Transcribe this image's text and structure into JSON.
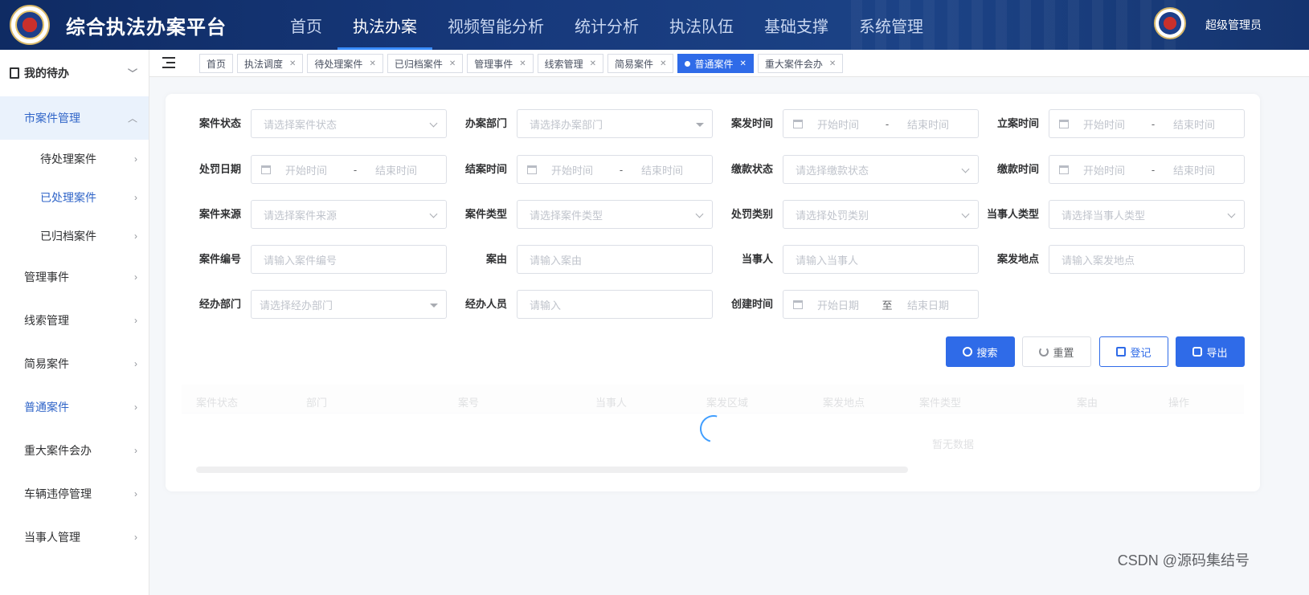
{
  "app": {
    "title": "综合执法办案平台",
    "username": "超级管理员"
  },
  "topnav": [
    {
      "label": "首页"
    },
    {
      "label": "执法办案"
    },
    {
      "label": "视频智能分析"
    },
    {
      "label": "统计分析"
    },
    {
      "label": "执法队伍"
    },
    {
      "label": "基础支撑"
    },
    {
      "label": "系统管理"
    }
  ],
  "topnav_active_index": 1,
  "sidebar": {
    "todo": "我的待办",
    "group": "市案件管理",
    "sub_items": [
      "待处理案件",
      "已处理案件",
      "已归档案件"
    ],
    "items": [
      "管理事件",
      "线索管理",
      "简易案件",
      "普通案件",
      "重大案件会办",
      "车辆违停管理",
      "当事人管理"
    ]
  },
  "tabs": [
    "首页",
    "执法调度",
    "待处理案件",
    "已归档案件",
    "管理事件",
    "线索管理",
    "简易案件",
    "普通案件",
    "重大案件会办"
  ],
  "active_tab_index": 7,
  "form": {
    "case_status": {
      "label": "案件状态",
      "placeholder": "请选择案件状态"
    },
    "dept": {
      "label": "办案部门",
      "placeholder": "请选择办案部门"
    },
    "incident_time": {
      "label": "案发时间",
      "start": "开始时间",
      "sep": "-",
      "end": "结束时间"
    },
    "filing_time": {
      "label": "立案时间",
      "start": "开始时间",
      "sep": "-",
      "end": "结束时间"
    },
    "penalty_date": {
      "label": "处罚日期",
      "start": "开始时间",
      "sep": "-",
      "end": "结束时间"
    },
    "close_time": {
      "label": "结案时间",
      "start": "开始时间",
      "sep": "-",
      "end": "结束时间"
    },
    "pay_status": {
      "label": "缴款状态",
      "placeholder": "请选择缴款状态"
    },
    "pay_time": {
      "label": "缴款时间",
      "start": "开始时间",
      "sep": "-",
      "end": "结束时间"
    },
    "case_source": {
      "label": "案件来源",
      "placeholder": "请选择案件来源"
    },
    "case_type": {
      "label": "案件类型",
      "placeholder": "请选择案件类型"
    },
    "penalty_type": {
      "label": "处罚类别",
      "placeholder": "请选择处罚类别"
    },
    "party_type": {
      "label": "当事人类型",
      "placeholder": "请选择当事人类型"
    },
    "case_no": {
      "label": "案件编号",
      "placeholder": "请输入案件编号"
    },
    "cause": {
      "label": "案由",
      "placeholder": "请输入案由"
    },
    "party": {
      "label": "当事人",
      "placeholder": "请输入当事人"
    },
    "location": {
      "label": "案发地点",
      "placeholder": "请输入案发地点"
    },
    "handling_dept": {
      "label": "经办部门",
      "placeholder": "请选择经办部门"
    },
    "handler": {
      "label": "经办人员",
      "placeholder": "请输入"
    },
    "created_time": {
      "label": "创建时间",
      "start": "开始日期",
      "sep": "至",
      "end": "结束日期"
    }
  },
  "buttons": {
    "search": "搜索",
    "reset": "重置",
    "register": "登记",
    "export": "导出"
  },
  "table": {
    "columns": [
      "案件状态",
      "部门",
      "案号",
      "当事人",
      "案发区域",
      "案发地点",
      "案件类型",
      "案由",
      "操作"
    ],
    "empty_text": "暂无数据"
  },
  "watermark": "CSDN @源码集结号",
  "colors": {
    "primary": "#2f6be8",
    "header": "#17397c"
  }
}
